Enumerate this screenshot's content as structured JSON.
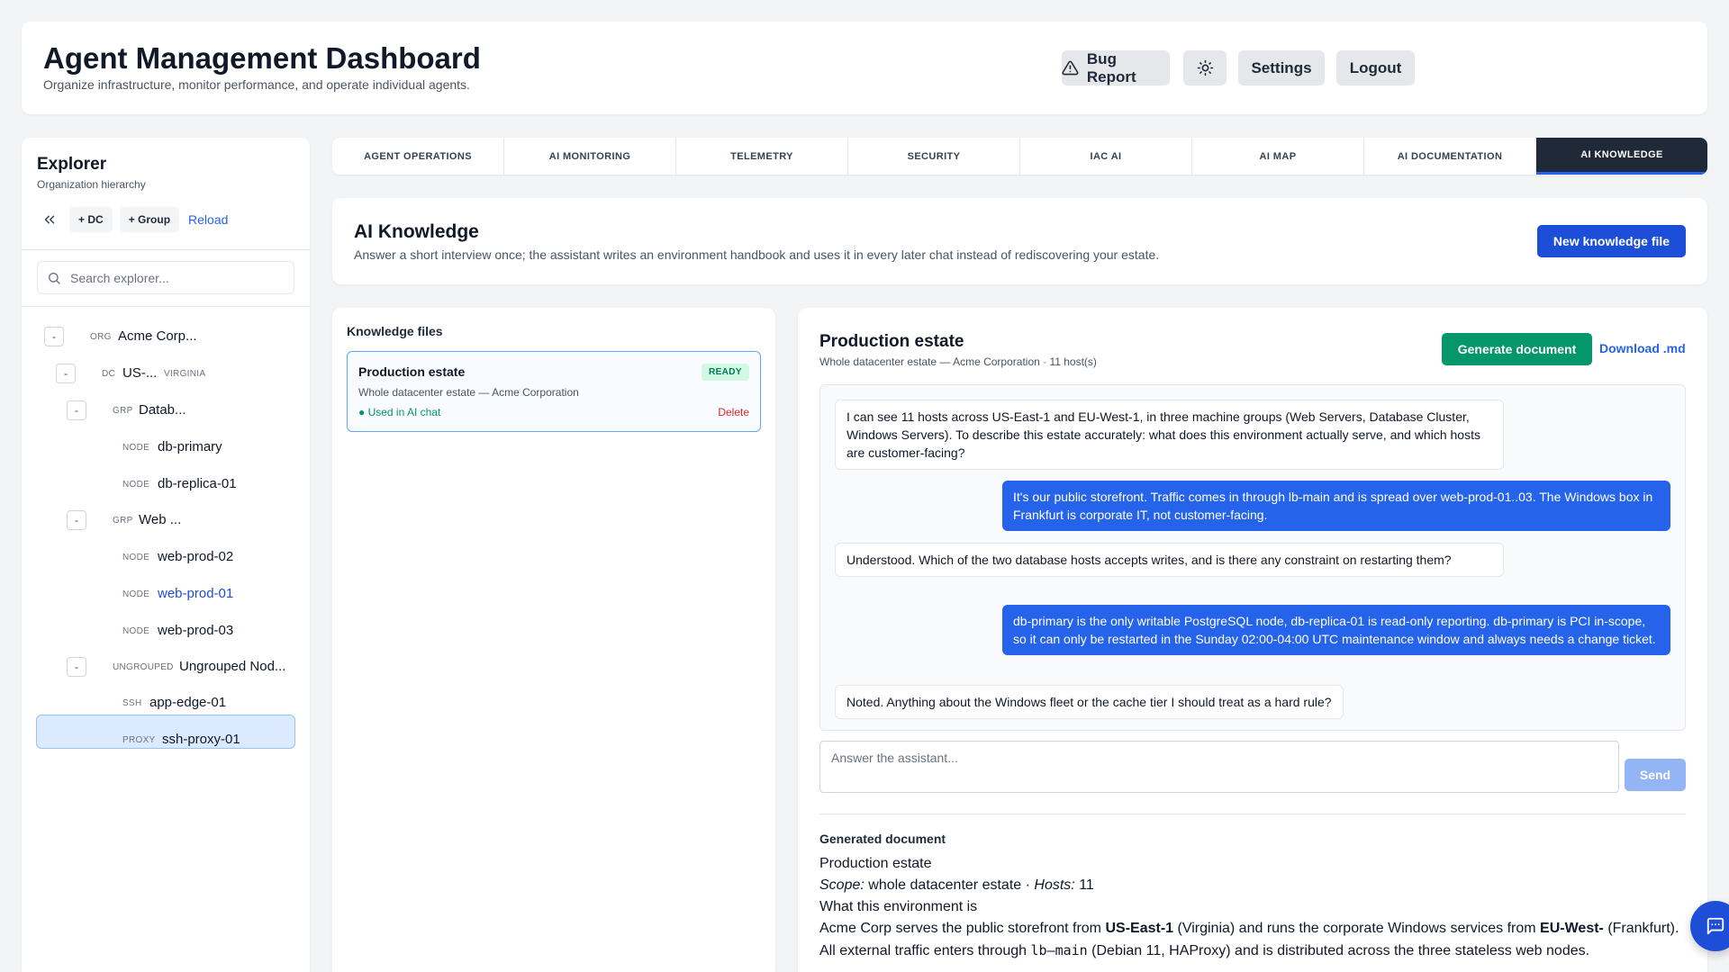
{
  "header": {
    "title": "Agent Management Dashboard",
    "subtitle": "Organize infrastructure, monitor performance, and operate individual agents.",
    "bug_report": "Bug Report",
    "settings": "Settings",
    "logout": "Logout"
  },
  "sidebar": {
    "title": "Explorer",
    "subtitle": "Organization hierarchy",
    "add_dc": "+ DC",
    "add_group": "+ Group",
    "reload": "Reload",
    "search_placeholder": "Search explorer...",
    "tree": [
      {
        "toggle": "-",
        "type": "ORG",
        "name": "Acme Corp..."
      },
      {
        "toggle": "-",
        "type": "DC",
        "name": "US-...",
        "sub": "VIRGINIA"
      },
      {
        "toggle": "-",
        "type": "GRP",
        "name": "Datab..."
      },
      {
        "type": "NODE",
        "name": "db-primary"
      },
      {
        "type": "NODE",
        "name": "db-replica-01"
      },
      {
        "toggle": "-",
        "type": "GRP",
        "name": "Web ..."
      },
      {
        "type": "NODE",
        "name": "web-prod-02"
      },
      {
        "type": "NODE",
        "name": "web-prod-01"
      },
      {
        "type": "NODE",
        "name": "web-prod-03"
      },
      {
        "toggle": "-",
        "type": "UNGROUPED",
        "name": "Ungrouped Nod..."
      },
      {
        "type": "SSH",
        "name": "app-edge-01"
      },
      {
        "type": "PROXY",
        "name": "ssh-proxy-01"
      }
    ]
  },
  "tabs": [
    {
      "label": "AGENT OPERATIONS"
    },
    {
      "label": "AI MONITORING"
    },
    {
      "label": "TELEMETRY"
    },
    {
      "label": "SECURITY"
    },
    {
      "label": "IAC AI"
    },
    {
      "label": "AI MAP"
    },
    {
      "label": "AI DOCUMENTATION"
    },
    {
      "label": "AI KNOWLEDGE"
    }
  ],
  "knowledge": {
    "title": "AI Knowledge",
    "subtitle": "Answer a short interview once; the assistant writes an environment handbook and uses it in every later chat instead of rediscovering your estate.",
    "new_button": "New knowledge file"
  },
  "files": {
    "label": "Knowledge files",
    "items": [
      {
        "name": "Production estate",
        "status": "READY",
        "desc": "Whole datacenter estate — Acme Corporation",
        "used": "● Used in AI chat",
        "delete": "Delete"
      }
    ]
  },
  "chat": {
    "title": "Production estate",
    "meta": "Whole datacenter estate — Acme Corporation · 11 host(s)",
    "generate": "Generate document",
    "download": "Download .md",
    "messages": [
      {
        "role": "ai",
        "text": "I can see 11 hosts across US-East-1 and EU-West-1, in three machine groups (Web Servers, Database Cluster, Windows Servers). To describe this estate accurately: what does this environment actually serve, and which hosts are customer-facing?"
      },
      {
        "role": "user",
        "text": "It's our public storefront. Traffic comes in through lb-main and is spread over web-prod-01..03. The Windows box in Frankfurt is corporate IT, not customer-facing."
      },
      {
        "role": "ai",
        "text": "Understood. Which of the two database hosts accepts writes, and is there any constraint on restarting them?"
      },
      {
        "role": "user",
        "text": "db-primary is the only writable PostgreSQL node, db-replica-01 is read-only reporting. db-primary is PCI in-scope, so it can only be restarted in the Sunday 02:00-04:00 UTC maintenance window and always needs a change ticket."
      },
      {
        "role": "ai",
        "text": "Noted. Anything about the Windows fleet or the cache tier I should treat as a hard rule?"
      }
    ],
    "answer_placeholder": "Answer the assistant...",
    "send": "Send"
  },
  "document": {
    "label": "Generated document",
    "heading": "Production estate",
    "scope_label": "Scope:",
    "scope_value": "whole datacenter estate ·",
    "hosts_label": "Hosts:",
    "hosts_value": "11",
    "section": "What this environment is",
    "p1": "Acme Corp serves the public storefront from",
    "r1": "US-East-1",
    "p2": "(Virginia) and runs the corporate Windows services from",
    "r2": "EU-West-",
    "p3": "(Frankfurt). All external traffic enters through",
    "code": "lb–main",
    "p4": "(Debian 11, HAProxy) and is distributed across the three stateless web",
    "p5": "nodes."
  },
  "colors": {
    "primary": "#1d4ed8",
    "accent": "#2563eb",
    "success": "#059669",
    "danger": "#dc2626",
    "dark_tab": "#1f2937"
  }
}
